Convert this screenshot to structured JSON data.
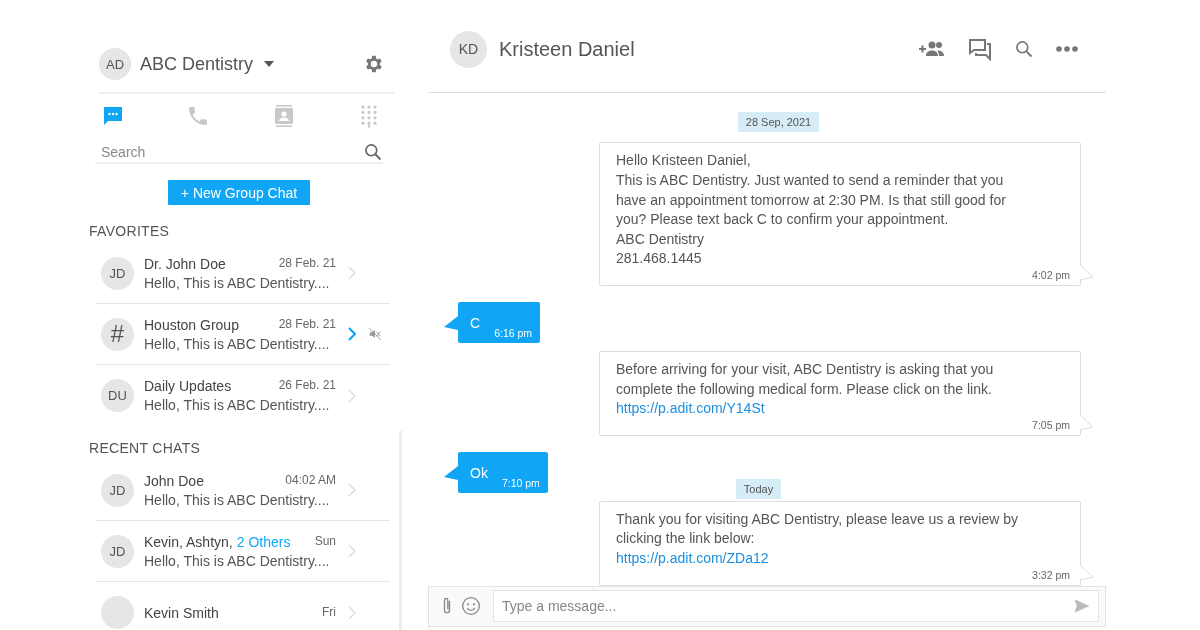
{
  "account": {
    "initials": "AD",
    "name": "ABC Dentistry"
  },
  "tabs": [
    {
      "kind": "chat",
      "selected": true
    },
    {
      "kind": "phone",
      "selected": false
    },
    {
      "kind": "contacts",
      "selected": false
    },
    {
      "kind": "dialpad",
      "selected": false
    }
  ],
  "search": {
    "placeholder": "Search"
  },
  "new_group_button": "+ New Group Chat",
  "sections": [
    {
      "title": "FAVORITES",
      "items": [
        {
          "avatar": "JD",
          "kind": "person",
          "name": "Dr. John Doe",
          "date": "28 Feb. 21",
          "preview": "Hello, This is ABC Dentistry....",
          "selected": false,
          "muted": false
        },
        {
          "avatar": "#",
          "kind": "group",
          "name": "Houston Group",
          "date": "28 Feb. 21",
          "preview": "Hello, This is ABC Dentistry....",
          "selected": true,
          "muted": true
        },
        {
          "avatar": "DU",
          "kind": "person",
          "name": "Daily Updates",
          "date": "26 Feb. 21",
          "preview": "Hello, This is ABC Dentistry....",
          "selected": false,
          "muted": false
        }
      ]
    },
    {
      "title": "RECENT CHATS",
      "items": [
        {
          "avatar": "JD",
          "kind": "person",
          "name": "John Doe",
          "date": "04:02 AM",
          "preview": "Hello, This is ABC Dentistry....",
          "selected": false,
          "muted": false
        },
        {
          "avatar": "JD",
          "kind": "person",
          "name": "Kevin, Ashtyn,",
          "others": "2 Others",
          "date": "Sun",
          "preview": "Hello, This is ABC Dentistry....",
          "selected": false,
          "muted": false
        },
        {
          "kind": "person",
          "name": "Kevin Smith",
          "date": "Fri",
          "selected": false,
          "muted": false
        }
      ]
    }
  ],
  "chat": {
    "initials": "KD",
    "name": "Kristeen Daniel"
  },
  "messages": [
    {
      "kind": "date",
      "text": "28 Sep, 2021"
    },
    {
      "kind": "outgoing",
      "lines": [
        "Hello Kristeen Daniel,",
        "This is ABC Dentistry. Just wanted to send a reminder that you",
        "have an appointment tomorrow at 2:30 PM. Is that still good for",
        "you? Please text back C to confirm your appointment.",
        "ABC Dentistry",
        "281.468.1445"
      ],
      "time": "4:02 pm"
    },
    {
      "kind": "incoming",
      "text": "C",
      "time": "6:16 pm"
    },
    {
      "kind": "outgoing",
      "lines": [
        "Before arriving for your visit, ABC Dentistry is asking that you",
        "complete the following medical form. Please click on the link."
      ],
      "link": "https://p.adit.com/Y14St",
      "time": "7:05 pm"
    },
    {
      "kind": "incoming",
      "text": "Ok",
      "time": "7:10 pm",
      "date_beside": "Today"
    },
    {
      "kind": "outgoing",
      "lines": [
        "Thank you for visiting ABC Dentistry, please leave us a review by",
        "clicking the link below:"
      ],
      "link": "https://p.adit.com/ZDa12",
      "time": "3:32 pm"
    }
  ],
  "composer": {
    "placeholder": "Type a message..."
  }
}
